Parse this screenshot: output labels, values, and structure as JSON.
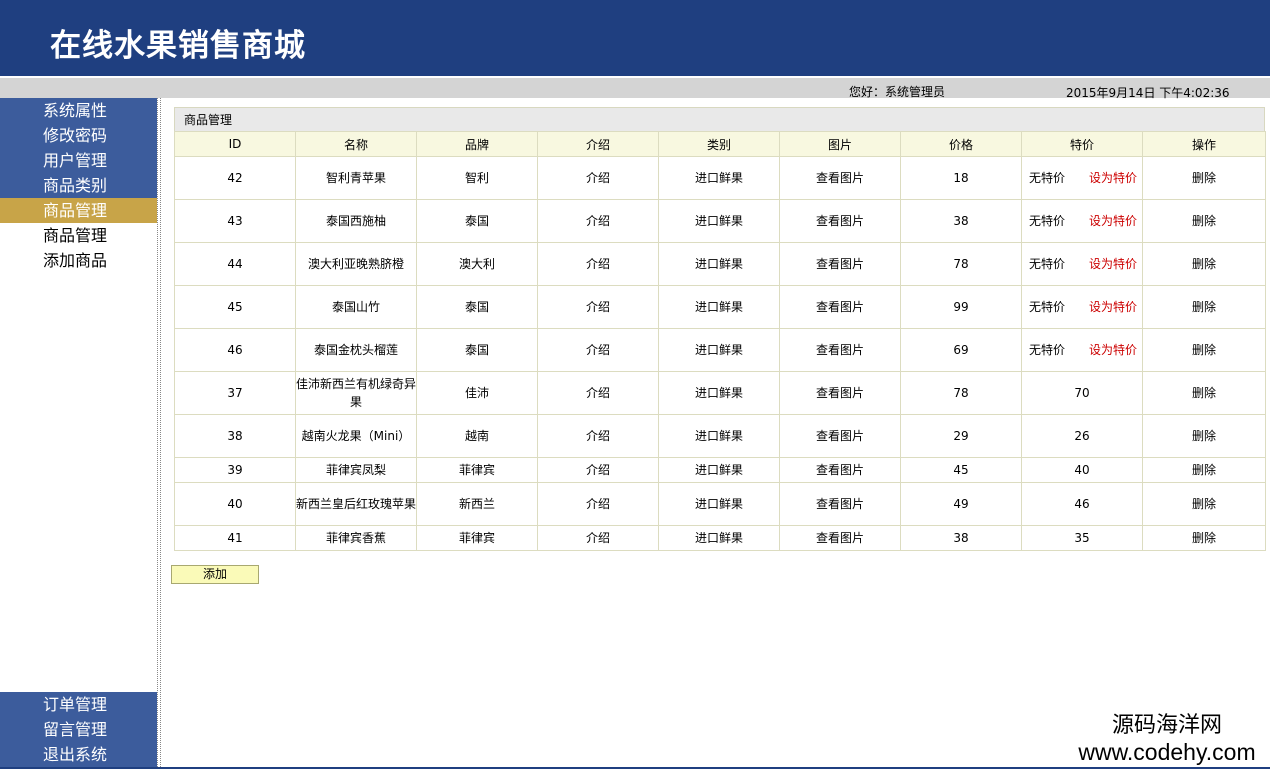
{
  "header": {
    "title": "在线水果销售商城"
  },
  "info": {
    "greeting": "您好：系统管理员",
    "datetime": "2015年9月14日 下午4:02:36"
  },
  "sidebar": {
    "top_items": [
      {
        "label": "系统属性"
      },
      {
        "label": "修改密码"
      },
      {
        "label": "用户管理"
      },
      {
        "label": "商品类别"
      },
      {
        "label": "商品管理",
        "active": true
      },
      {
        "label": "商品管理",
        "sub": true
      },
      {
        "label": "添加商品",
        "sub": true
      }
    ],
    "bottom_items": [
      {
        "label": "订单管理"
      },
      {
        "label": "留言管理"
      },
      {
        "label": "退出系统"
      }
    ]
  },
  "panel": {
    "title": "商品管理"
  },
  "table": {
    "columns": [
      "ID",
      "名称",
      "品牌",
      "介绍",
      "类别",
      "图片",
      "价格",
      "特价",
      "操作"
    ],
    "rows": [
      {
        "id": "42",
        "name": "智利青苹果",
        "brand": "智利",
        "intro": "介绍",
        "category": "进口鲜果",
        "image": "查看图片",
        "price": "18",
        "special": "",
        "no_special": "无特价",
        "set_special": "设为特价",
        "action": "删除"
      },
      {
        "id": "43",
        "name": "泰国西施柚",
        "brand": "泰国",
        "intro": "介绍",
        "category": "进口鲜果",
        "image": "查看图片",
        "price": "38",
        "special": "",
        "no_special": "无特价",
        "set_special": "设为特价",
        "action": "删除"
      },
      {
        "id": "44",
        "name": "澳大利亚晚熟脐橙",
        "brand": "澳大利",
        "intro": "介绍",
        "category": "进口鲜果",
        "image": "查看图片",
        "price": "78",
        "special": "",
        "no_special": "无特价",
        "set_special": "设为特价",
        "action": "删除"
      },
      {
        "id": "45",
        "name": "泰国山竹",
        "brand": "泰国",
        "intro": "介绍",
        "category": "进口鲜果",
        "image": "查看图片",
        "price": "99",
        "special": "",
        "no_special": "无特价",
        "set_special": "设为特价",
        "action": "删除"
      },
      {
        "id": "46",
        "name": "泰国金枕头榴莲",
        "brand": "泰国",
        "intro": "介绍",
        "category": "进口鲜果",
        "image": "查看图片",
        "price": "69",
        "special": "",
        "no_special": "无特价",
        "set_special": "设为特价",
        "action": "删除"
      },
      {
        "id": "37",
        "name": "佳沛新西兰有机绿奇异果",
        "brand": "佳沛",
        "intro": "介绍",
        "category": "进口鲜果",
        "image": "查看图片",
        "price": "78",
        "special": "70",
        "action": "删除"
      },
      {
        "id": "38",
        "name": "越南火龙果（Mini）",
        "brand": "越南",
        "intro": "介绍",
        "category": "进口鲜果",
        "image": "查看图片",
        "price": "29",
        "special": "26",
        "action": "删除"
      },
      {
        "id": "39",
        "name": "菲律宾凤梨",
        "brand": "菲律宾",
        "intro": "介绍",
        "category": "进口鲜果",
        "image": "查看图片",
        "price": "45",
        "special": "40",
        "action": "删除"
      },
      {
        "id": "40",
        "name": "新西兰皇后红玫瑰苹果",
        "brand": "新西兰",
        "intro": "介绍",
        "category": "进口鲜果",
        "image": "查看图片",
        "price": "49",
        "special": "46",
        "action": "删除"
      },
      {
        "id": "41",
        "name": "菲律宾香蕉",
        "brand": "菲律宾",
        "intro": "介绍",
        "category": "进口鲜果",
        "image": "查看图片",
        "price": "38",
        "special": "35",
        "action": "删除"
      }
    ]
  },
  "buttons": {
    "add_label": "添加"
  },
  "watermark": {
    "line1": "源码海洋网",
    "line2": "www.codehy.com"
  },
  "colors": {
    "header_bg": "#1f3f80",
    "menu_bg": "#3c5c9c",
    "menu_active_bg": "#c8a448",
    "link_red": "#cc0000"
  }
}
